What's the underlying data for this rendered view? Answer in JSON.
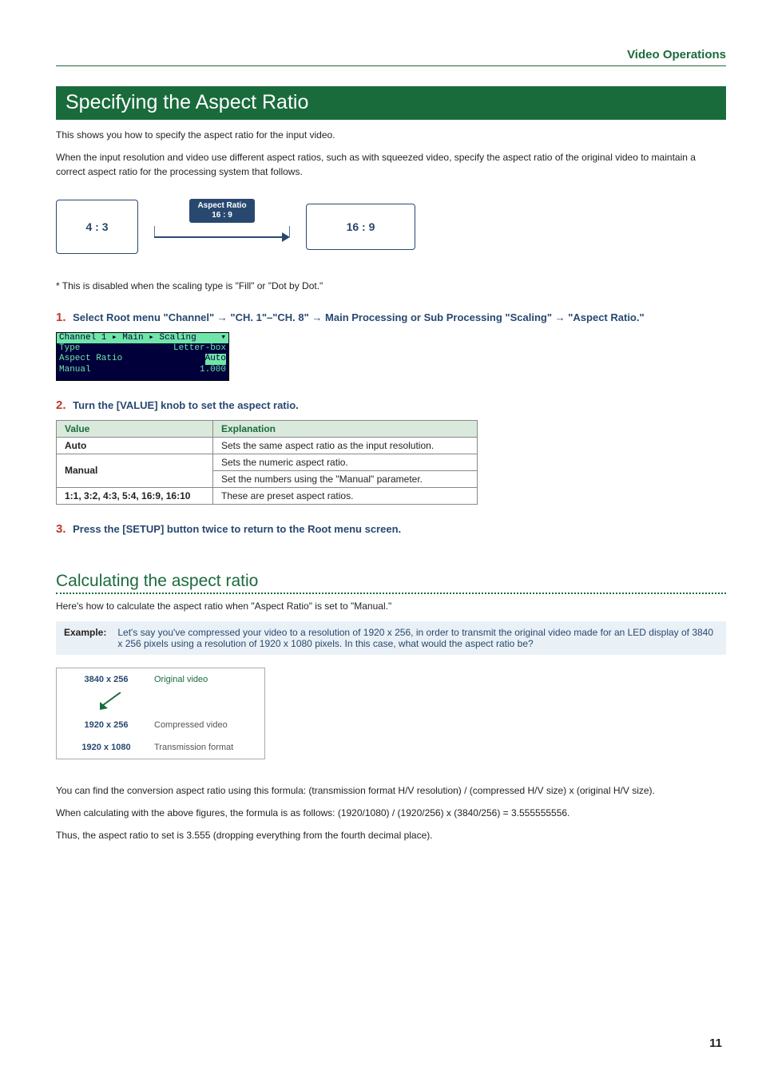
{
  "header": {
    "section": "Video Operations",
    "page_number": "11"
  },
  "title": "Specifying the Aspect Ratio",
  "intro": {
    "line1": "This shows you how to specify the aspect ratio for the input video.",
    "line2": "When the input resolution and video use different aspect ratios, such as with squeezed video, specify the aspect ratio of the original video to maintain a correct aspect ratio for the processing system that follows."
  },
  "diagram1": {
    "left_ratio": "4 : 3",
    "label_title": "Aspect Ratio",
    "label_ratio": "16 : 9",
    "right_ratio": "16 : 9"
  },
  "note_disabled": "*  This is disabled when the scaling type is \"Fill\" or \"Dot by Dot.\"",
  "steps": {
    "s1": {
      "num": "1.",
      "prefix": "Select Root menu \"Channel\"",
      "seg2": "\"CH. 1\"–\"CH. 8\"",
      "seg3": "Main Processing or Sub Processing \"Scaling\"",
      "seg4": "\"Aspect Ratio.\""
    },
    "s2": {
      "num": "2.",
      "text": "Turn the [VALUE] knob to set the aspect ratio."
    },
    "s3": {
      "num": "3.",
      "text": "Press the [SETUP] button twice to return to the Root menu screen."
    }
  },
  "menu": {
    "breadcrumb": "Channel 1 ▸ Main ▸ Scaling",
    "r1k": "Type",
    "r1v": "Letter-box",
    "r2k": "Aspect Ratio",
    "r2v": "Auto",
    "r3k": " Manual",
    "r3v": "1.000"
  },
  "table": {
    "h1": "Value",
    "h2": "Explanation",
    "r1c1": "Auto",
    "r1c2": "Sets the same aspect ratio as the input resolution.",
    "r2c1": "Manual",
    "r2c2a": "Sets the numeric aspect ratio.",
    "r2c2b": "Set the numbers using the \"Manual\" parameter.",
    "r3c1": "1:1, 3:2, 4:3, 5:4, 16:9, 16:10",
    "r3c2": "These are preset aspect ratios."
  },
  "sub": {
    "heading": "Calculating the aspect ratio",
    "intro": "Here's how to calculate the aspect ratio when \"Aspect Ratio\" is set to \"Manual.\"",
    "example_label": "Example:",
    "example_text": "Let's say you've compressed your video to a resolution of 1920 x 256, in order to transmit the original video made for an LED display of 3840 x 256 pixels using a resolution of 1920 x 1080 pixels. In this case, what would the aspect ratio be?"
  },
  "diag2": {
    "r1res": "3840 x 256",
    "r1cap": "Original video",
    "r2res": "1920 x 256",
    "r2cap": "Compressed video",
    "r3res": "1920 x 1080",
    "r3cap": "Transmission format"
  },
  "calc": {
    "p1": "You can find the conversion aspect ratio using this formula: (transmission format H/V resolution) / (compressed H/V size) x (original H/V size).",
    "p2": "When calculating with the above figures, the formula is as follows: (1920/1080) / (1920/256) x (3840/256) = 3.555555556.",
    "p3": "Thus, the aspect ratio to set is 3.555 (dropping everything from the fourth decimal place)."
  }
}
